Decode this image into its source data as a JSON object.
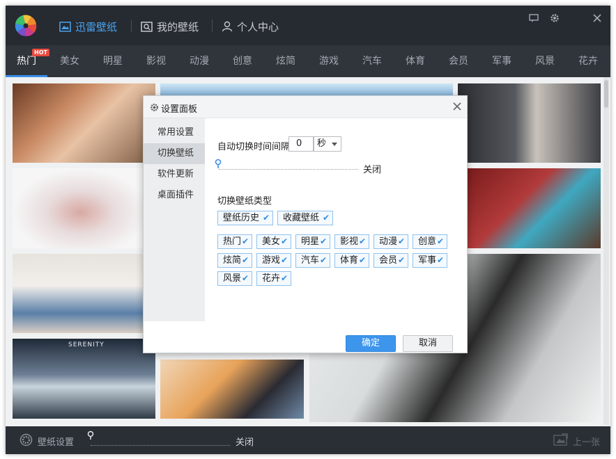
{
  "nav": {
    "xunlei_wallpaper": "迅雷壁纸",
    "my_wallpaper": "我的壁纸",
    "personal_center": "个人中心"
  },
  "categories": [
    "热门",
    "美女",
    "明星",
    "影视",
    "动漫",
    "创意",
    "炫简",
    "游戏",
    "汽车",
    "体育",
    "会员",
    "军事",
    "风景",
    "花卉"
  ],
  "hot_badge": "HOT",
  "dialog": {
    "title": "设置面板",
    "side_items": [
      "常用设置",
      "切换壁纸",
      "软件更新",
      "桌面插件"
    ],
    "active_side": "切换壁纸",
    "interval_label": "自动切换时间间隔:",
    "interval_value": "0",
    "interval_unit": "秒",
    "slider_end_label": "关闭",
    "type_label": "切换壁纸类型",
    "sources": [
      "壁纸历史",
      "收藏壁纸"
    ],
    "types": [
      "热门",
      "美女",
      "明星",
      "影视",
      "动漫",
      "创意",
      "炫简",
      "游戏",
      "汽车",
      "体育",
      "会员",
      "军事",
      "风景",
      "花卉"
    ],
    "ok": "确定",
    "cancel": "取消"
  },
  "thumbnails": {
    "serenity_text": "SERENITY"
  },
  "bottom": {
    "settings": "壁纸设置",
    "slider_end_label": "关闭",
    "prev": "上一张"
  },
  "colors": {
    "accent": "#3b8ee8",
    "topbar": "#262a31",
    "catbar": "#30343b",
    "check": "#2e8de0"
  }
}
